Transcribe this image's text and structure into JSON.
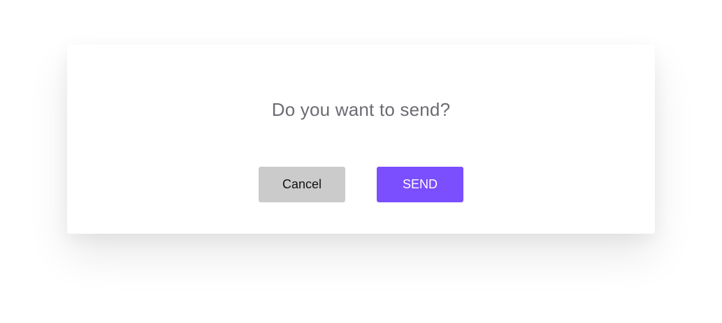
{
  "dialog": {
    "question": "Do you want to send?",
    "cancel_label": "Cancel",
    "send_label": "SEND"
  },
  "colors": {
    "accent": "#7b4efe",
    "cancel_background": "#cbcbcb",
    "question_text": "#6b6b72"
  }
}
